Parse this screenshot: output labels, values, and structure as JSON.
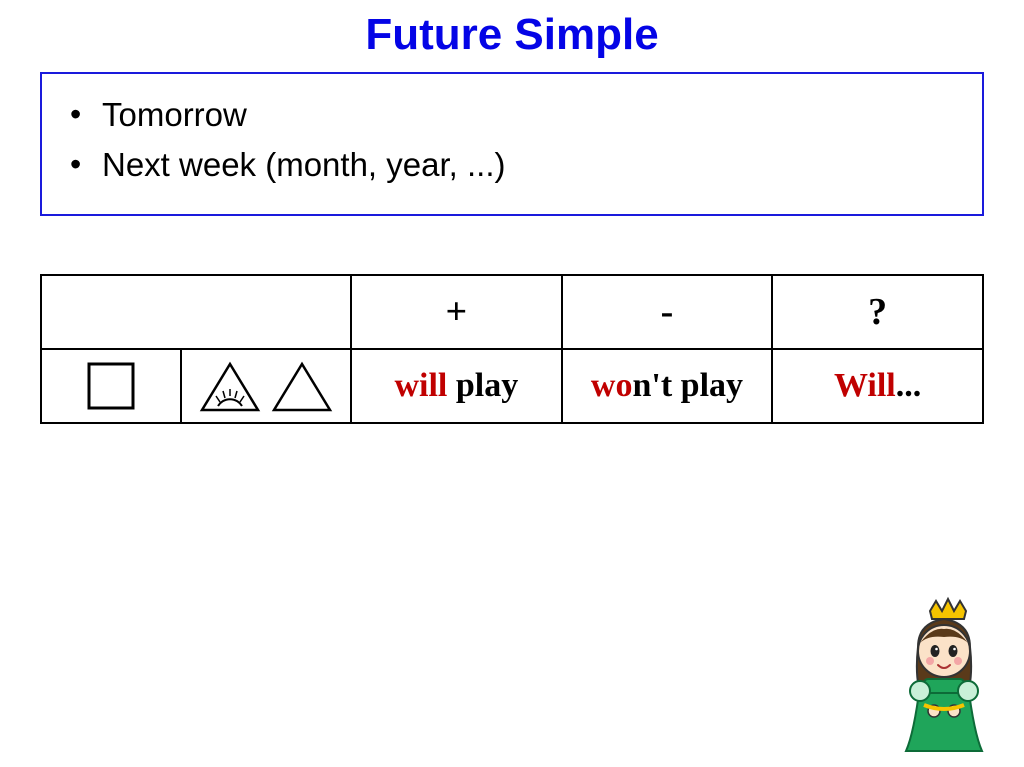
{
  "title": "Future Simple",
  "indicators": {
    "items": [
      "Tomorrow",
      "Next week (month, year, ...)"
    ]
  },
  "table": {
    "headers": {
      "plus": "+",
      "minus": "-",
      "question": "?"
    },
    "row": {
      "positive": {
        "aux": "will",
        "verb": " play"
      },
      "negative": {
        "aux": "wo",
        "rest": "n't play"
      },
      "interrogative": {
        "aux": "Will",
        "rest": "..."
      }
    }
  }
}
